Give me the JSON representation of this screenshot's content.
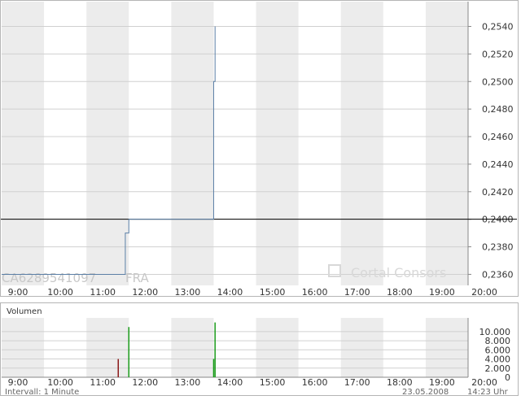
{
  "chart_data": [
    {
      "type": "line",
      "id": "price",
      "instrument": "CA6289541097",
      "exchange": "FRA",
      "watermark": "Cortal Consors",
      "x_ticks": [
        "9:00",
        "10:00",
        "11:00",
        "12:00",
        "13:00",
        "14:00",
        "15:00",
        "16:00",
        "17:00",
        "18:00",
        "19:00",
        "20:00"
      ],
      "y_ticks": [
        "0,2360",
        "0,2380",
        "0,2400",
        "0,2420",
        "0,2440",
        "0,2460",
        "0,2480",
        "0,2500",
        "0,2520",
        "0,2540"
      ],
      "ylim": [
        0.2352,
        0.2558
      ],
      "reference_line": 0.24,
      "series": [
        {
          "values": [
            [
              "9:00",
              0.236
            ],
            [
              "11:55",
              0.236
            ],
            [
              "11:55",
              0.239
            ],
            [
              "12:00",
              0.239
            ],
            [
              "12:00",
              0.24
            ],
            [
              "14:00",
              0.24
            ],
            [
              "14:00",
              0.25
            ],
            [
              "14:02",
              0.25
            ],
            [
              "14:02",
              0.254
            ]
          ]
        }
      ],
      "colors": {
        "line": "#5b7fa6",
        "reference": "#000000",
        "shade": "#ececec"
      }
    },
    {
      "type": "bar",
      "id": "volume",
      "title": "Volumen",
      "x_ticks": [
        "9:00",
        "10:00",
        "11:00",
        "12:00",
        "13:00",
        "14:00",
        "15:00",
        "16:00",
        "17:00",
        "18:00",
        "19:00",
        "20:00"
      ],
      "y_ticks": [
        "0",
        "2.000",
        "4.000",
        "6.000",
        "8.000",
        "10.000"
      ],
      "ylim": [
        0,
        13000
      ],
      "bars": [
        {
          "time": "11:45",
          "value": 4000,
          "color": "#8b1a1a"
        },
        {
          "time": "12:00",
          "value": 11000,
          "color": "#1a9b1a"
        },
        {
          "time": "14:00",
          "value": 4000,
          "color": "#1a9b1a"
        },
        {
          "time": "14:02",
          "value": 12000,
          "color": "#1a9b1a"
        }
      ]
    }
  ],
  "footer": {
    "interval": "Intervall: 1 Minute",
    "date": "23.05.2008",
    "time": "14:23 Uhr"
  }
}
